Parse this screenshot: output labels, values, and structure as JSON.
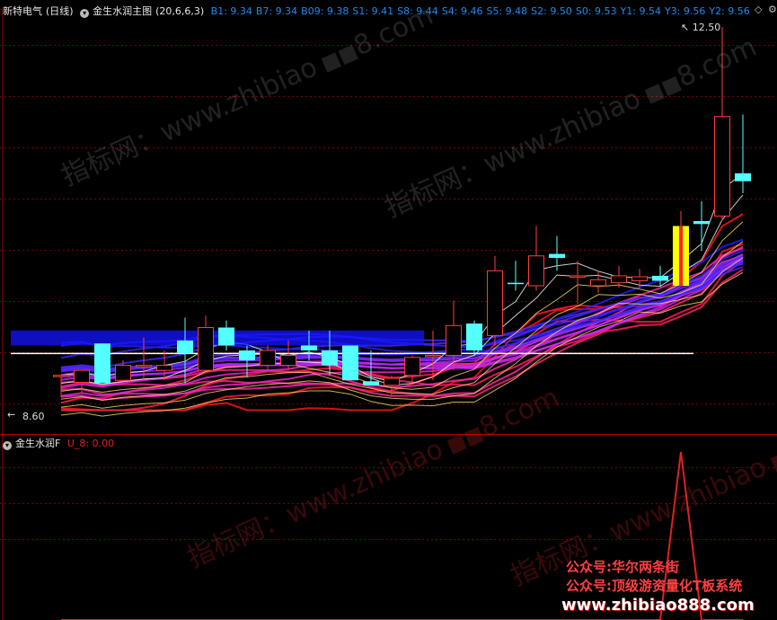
{
  "header": {
    "stock": "新特电气",
    "period": "(日线)",
    "indicator": "金生水润主图",
    "params": "(20,6,6,3)",
    "levels": [
      {
        "label": "B1",
        "value": "9.34"
      },
      {
        "label": "B7",
        "value": "9.34"
      },
      {
        "label": "B09",
        "value": "9.38"
      },
      {
        "label": "S1",
        "value": "9.41"
      },
      {
        "label": "S8",
        "value": "9.44"
      },
      {
        "label": "S4",
        "value": "9.46"
      },
      {
        "label": "S5",
        "value": "9.48"
      },
      {
        "label": "S2",
        "value": "9.50"
      },
      {
        "label": "S0",
        "value": "9.53"
      },
      {
        "label": "Y1",
        "value": "9.54"
      },
      {
        "label": "Y3",
        "value": "9.56"
      },
      {
        "label": "Y2",
        "value": "9.56"
      }
    ]
  },
  "sub_header": {
    "indicator": "金生水润F",
    "line_label": "U_8: 0.00"
  },
  "price_high_label": "12.50",
  "price_low_label": "8.60",
  "watermarks": [
    "指标网：www.zhibiao",
    "8.com"
  ],
  "promo": {
    "line1": "公众号:华尔两条街",
    "line2": "公众号:顶级游资量化T板系统",
    "line3": "www.zhibiao888.com"
  },
  "colors": {
    "up": "#ff3c3c",
    "down": "#54ffff",
    "ribbon_blue": "#1414ff",
    "signal": "#ffff00"
  },
  "chart_data": [
    {
      "type": "candlestick",
      "ylim": [
        8.6,
        12.5
      ],
      "candles": [
        {
          "o": 9.0,
          "h": 9.0,
          "l": 8.78,
          "c": 9.0
        },
        {
          "o": 8.93,
          "h": 9.05,
          "l": 8.82,
          "c": 9.05
        },
        {
          "o": 9.32,
          "h": 9.32,
          "l": 8.92,
          "c": 8.92
        },
        {
          "o": 8.95,
          "h": 9.15,
          "l": 8.95,
          "c": 9.1
        },
        {
          "o": 9.1,
          "h": 9.38,
          "l": 8.95,
          "c": 9.1
        },
        {
          "o": 9.05,
          "h": 9.25,
          "l": 8.95,
          "c": 9.1
        },
        {
          "o": 9.35,
          "h": 9.58,
          "l": 8.92,
          "c": 9.22
        },
        {
          "o": 9.05,
          "h": 9.6,
          "l": 9.05,
          "c": 9.48
        },
        {
          "o": 9.48,
          "h": 9.55,
          "l": 9.25,
          "c": 9.3
        },
        {
          "o": 9.25,
          "h": 9.3,
          "l": 8.98,
          "c": 9.15
        },
        {
          "o": 9.1,
          "h": 9.3,
          "l": 9.05,
          "c": 9.25
        },
        {
          "o": 9.1,
          "h": 9.35,
          "l": 9.05,
          "c": 9.2
        },
        {
          "o": 9.3,
          "h": 9.45,
          "l": 9.15,
          "c": 9.25
        },
        {
          "o": 9.25,
          "h": 9.45,
          "l": 9.0,
          "c": 9.1
        },
        {
          "o": 9.3,
          "h": 9.3,
          "l": 8.95,
          "c": 8.95
        },
        {
          "o": 8.94,
          "h": 9.25,
          "l": 8.9,
          "c": 8.9
        },
        {
          "o": 8.9,
          "h": 9.0,
          "l": 8.8,
          "c": 8.97
        },
        {
          "o": 9.0,
          "h": 9.2,
          "l": 8.92,
          "c": 9.18
        },
        {
          "o": 9.2,
          "h": 9.45,
          "l": 8.95,
          "c": 9.2
        },
        {
          "o": 9.2,
          "h": 9.75,
          "l": 9.05,
          "c": 9.5
        },
        {
          "o": 9.52,
          "h": 9.55,
          "l": 9.2,
          "c": 9.25
        },
        {
          "o": 9.4,
          "h": 10.2,
          "l": 9.3,
          "c": 10.05
        },
        {
          "o": 9.93,
          "h": 10.15,
          "l": 9.85,
          "c": 9.92
        },
        {
          "o": 9.9,
          "h": 10.5,
          "l": 9.85,
          "c": 10.2
        },
        {
          "o": 10.22,
          "h": 10.4,
          "l": 10.05,
          "c": 10.18
        },
        {
          "o": 10.0,
          "h": 10.15,
          "l": 9.72,
          "c": 10.0
        },
        {
          "o": 9.9,
          "h": 10.05,
          "l": 9.83,
          "c": 9.96
        },
        {
          "o": 9.93,
          "h": 10.1,
          "l": 9.88,
          "c": 10.0
        },
        {
          "o": 9.95,
          "h": 10.07,
          "l": 9.88,
          "c": 9.99
        },
        {
          "o": 10.0,
          "h": 10.1,
          "l": 9.9,
          "c": 9.95
        },
        {
          "o": 9.9,
          "h": 10.65,
          "l": 9.9,
          "c": 10.5
        },
        {
          "o": 10.55,
          "h": 10.75,
          "l": 10.25,
          "c": 10.52
        },
        {
          "o": 10.6,
          "h": 12.5,
          "l": 10.55,
          "c": 11.6
        },
        {
          "o": 11.03,
          "h": 11.62,
          "l": 10.83,
          "c": 10.95
        }
      ],
      "signal_candle_index": 30
    },
    {
      "type": "line",
      "series": [
        {
          "name": "U_8",
          "values": [
            0,
            0,
            0,
            0,
            0,
            0,
            0,
            0,
            0,
            0,
            0,
            0,
            0,
            0,
            0,
            0,
            0,
            0,
            0,
            0,
            0,
            0,
            0,
            0,
            0,
            0,
            0,
            0,
            0,
            0,
            1,
            0,
            0,
            0
          ]
        }
      ],
      "ylim": [
        0,
        1
      ]
    }
  ]
}
